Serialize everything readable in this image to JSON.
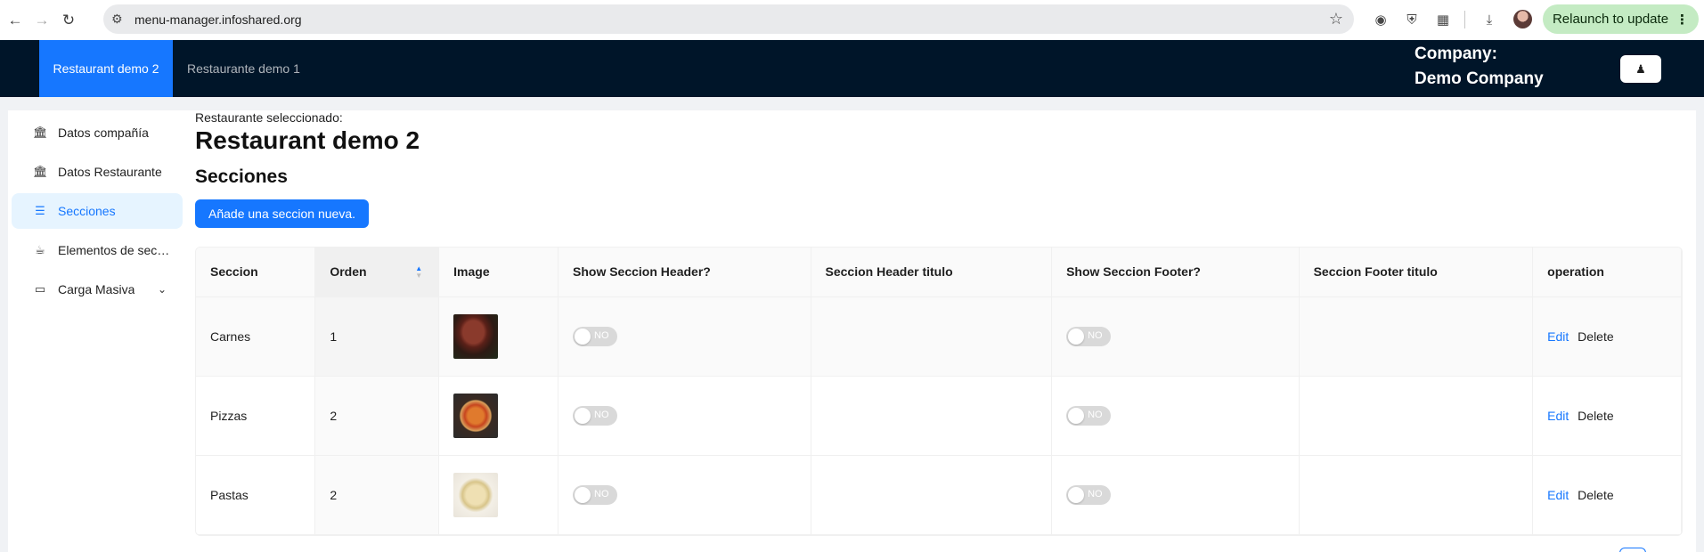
{
  "browser": {
    "url": "menu-manager.infoshared.org",
    "relaunch_label": "Relaunch to update"
  },
  "header": {
    "tabs": [
      {
        "label": "Restaurant demo 2"
      },
      {
        "label": "Restaurante demo 1"
      }
    ],
    "company_label": "Company:",
    "company_name": "Demo Company"
  },
  "sidebar": {
    "items": [
      {
        "label": "Datos compañía",
        "icon": "bank-icon"
      },
      {
        "label": "Datos Restaurante",
        "icon": "bank-icon"
      },
      {
        "label": "Secciones",
        "icon": "menu-icon"
      },
      {
        "label": "Elementos de secc...",
        "icon": "coffee-icon"
      },
      {
        "label": "Carga Masiva",
        "icon": "laptop-icon"
      }
    ]
  },
  "main": {
    "selected_label": "Restaurante seleccionado:",
    "restaurant_name": "Restaurant demo 2",
    "section_title": "Secciones",
    "add_button": "Añade una seccion nueva."
  },
  "table": {
    "columns": [
      "Seccion",
      "Orden",
      "Image",
      "Show Seccion Header?",
      "Seccion Header titulo",
      "Show Seccion Footer?",
      "Seccion Footer titulo",
      "operation"
    ],
    "rows": [
      {
        "seccion": "Carnes",
        "orden": "1",
        "image": "meat-image",
        "header_switch": "NO",
        "header_title": "",
        "footer_switch": "NO",
        "footer_title": "",
        "edit": "Edit",
        "delete": "Delete"
      },
      {
        "seccion": "Pizzas",
        "orden": "2",
        "image": "pizza-image",
        "header_switch": "NO",
        "header_title": "",
        "footer_switch": "NO",
        "footer_title": "",
        "edit": "Edit",
        "delete": "Delete"
      },
      {
        "seccion": "Pastas",
        "orden": "2",
        "image": "pasta-image",
        "header_switch": "NO",
        "header_title": "",
        "footer_switch": "NO",
        "footer_title": "",
        "edit": "Edit",
        "delete": "Delete"
      }
    ]
  },
  "colors": {
    "primary": "#1677ff",
    "header_bg": "#001529",
    "relaunch_bg": "#c4ebc3"
  }
}
